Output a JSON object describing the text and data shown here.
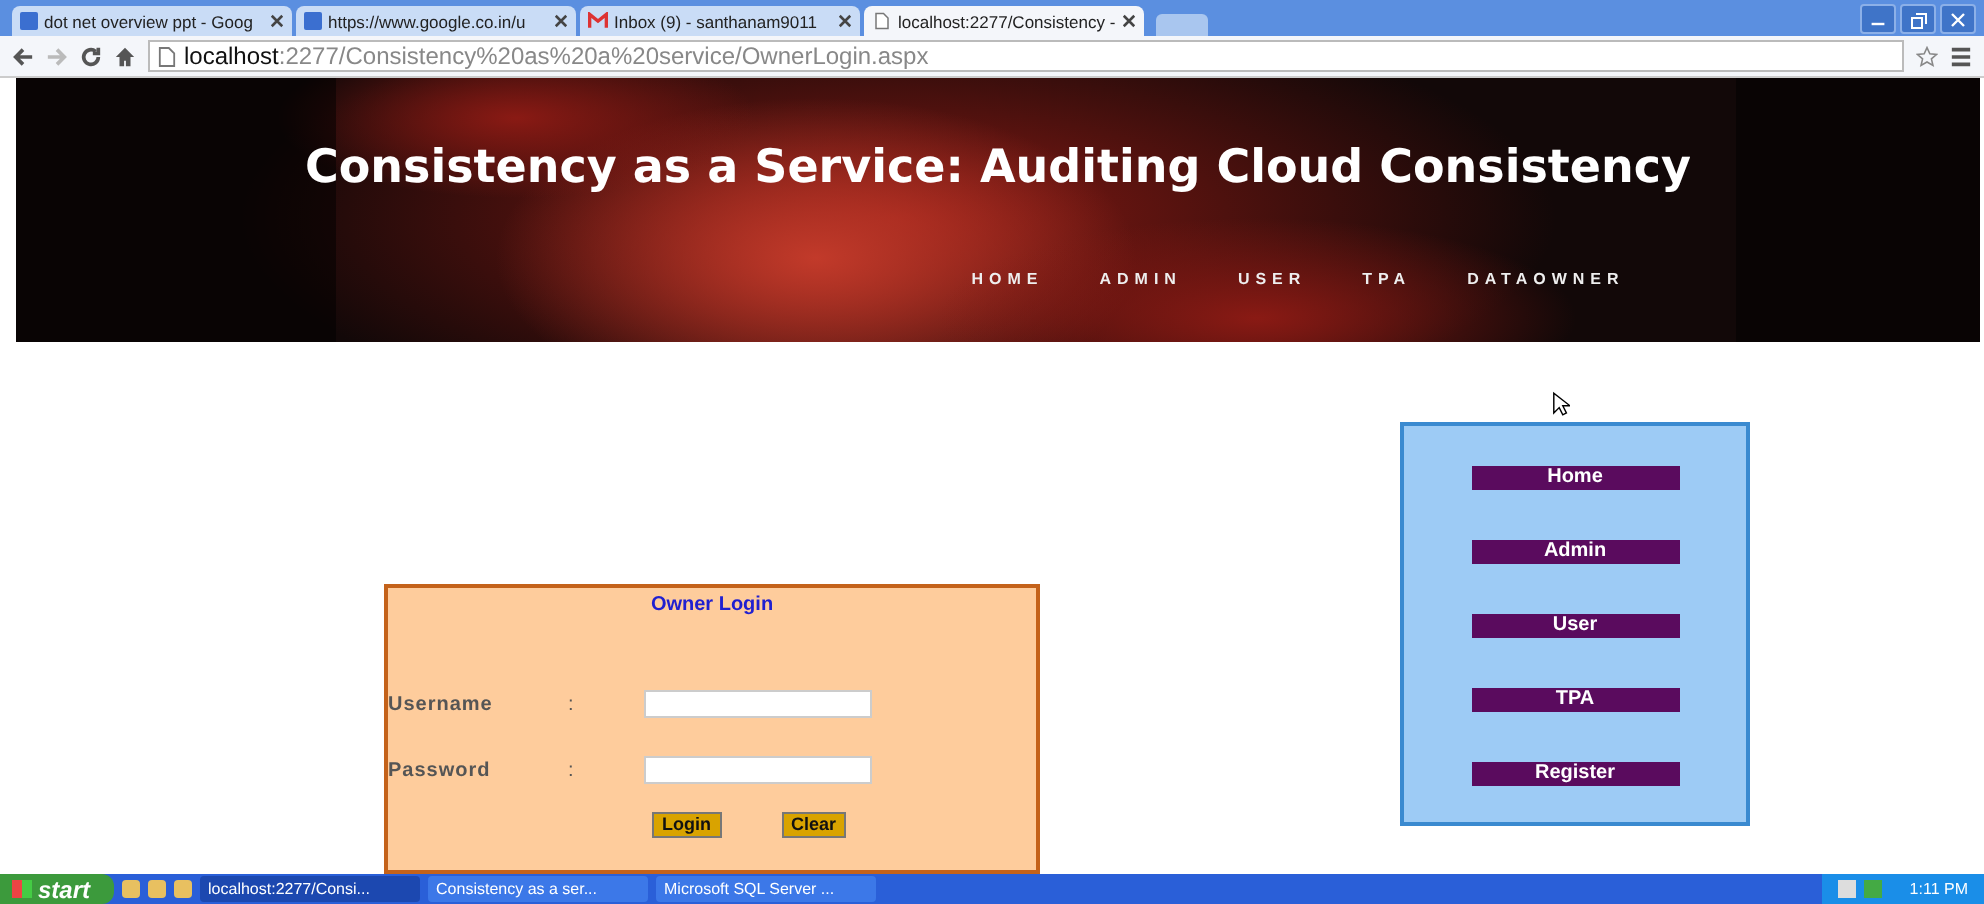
{
  "browser": {
    "tabs": [
      {
        "title": "dot net overview ppt - Goog",
        "kind": "g",
        "selected": false
      },
      {
        "title": "https://www.google.co.in/u",
        "kind": "g",
        "selected": false
      },
      {
        "title": "Inbox (9) - santhanam9011",
        "kind": "mail",
        "selected": false
      },
      {
        "title": "localhost:2277/Consistency -",
        "kind": "page",
        "selected": true
      }
    ],
    "address": {
      "host": "localhost",
      "rest": ":2277/Consistency%20as%20a%20service/OwnerLogin.aspx"
    }
  },
  "header": {
    "title": "Consistency as a Service: Auditing Cloud Consistency",
    "nav": [
      "HOME",
      "ADMIN",
      "USER",
      "TPA",
      "DATAOWNER"
    ]
  },
  "login": {
    "title": "Owner Login",
    "fields": [
      {
        "label": "Username",
        "separator": ":"
      },
      {
        "label": "Password",
        "separator": ":"
      }
    ],
    "buttons": [
      "Login",
      "Clear"
    ]
  },
  "side_menu": [
    "Home",
    "Admin",
    "User",
    "TPA",
    "Register"
  ],
  "taskbar": {
    "start": "start",
    "tasks": [
      {
        "label": "localhost:2277/Consi...",
        "selected": true
      },
      {
        "label": "Consistency as a ser...",
        "selected": false
      },
      {
        "label": "Microsoft SQL Server ...",
        "selected": false
      }
    ],
    "clock": "1:11 PM"
  }
}
